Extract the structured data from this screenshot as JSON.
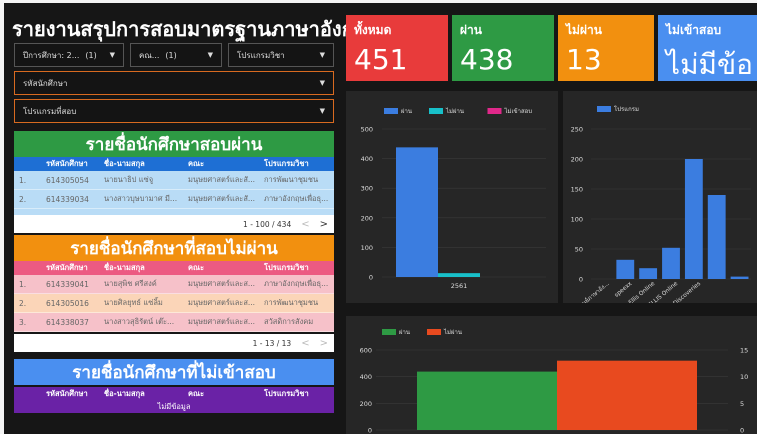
{
  "title": "รายงานสรุปการสอบมาตรฐานภาษาอังกฤษ",
  "filters": {
    "year": {
      "label": "ปีการศึกษา: 2...",
      "count": "(1)"
    },
    "faculty": {
      "label": "คณ...",
      "count": "(1)"
    },
    "program": {
      "label": "โปรแกรมวิชา"
    },
    "student_id": {
      "label": "รหัสนักศึกษา"
    },
    "exam_program": {
      "label": "โปรแกรมที่สอบ"
    }
  },
  "colors": {
    "passed": "#2e9a44",
    "failed": "#f2900f",
    "absent": "#4a8ff0",
    "total": "#e83b3b",
    "purple": "#6a22a6"
  },
  "cards": [
    {
      "label": "ทั้งหมด",
      "value": "451"
    },
    {
      "label": "ผ่าน",
      "value": "438"
    },
    {
      "label": "ไม่ผ่าน",
      "value": "13"
    },
    {
      "label": "ไม่เข้าสอบ",
      "value": "ไม่มีข้อ"
    }
  ],
  "columns": [
    "รหัสนักศึกษา",
    "ชื่อ-นามสกุล",
    "คณะ",
    "โปรแกรมวิชา"
  ],
  "passed": {
    "title": "รายชื่อนักศึกษาสอบผ่าน",
    "rows": [
      {
        "no": "1.",
        "id": "614305054",
        "name": "นายนาธิป แซ่จู",
        "faculty": "มนุษยศาสตร์และสั...",
        "program": "การพัฒนาชุมชน"
      },
      {
        "no": "2.",
        "id": "614339034",
        "name": "นางสาวบุษบามาศ มี...",
        "faculty": "มนุษยศาสตร์และสั...",
        "program": "ภาษาอังกฤษเพื่อธุ..."
      }
    ],
    "pager": "1 - 100 / 434"
  },
  "failed": {
    "title": "รายชื่อนักศึกษาที่สอบไม่ผ่าน",
    "rows": [
      {
        "no": "1.",
        "id": "614339041",
        "name": "นายสุพิช ศรีสงค์",
        "faculty": "มนุษยศาสตร์และส...",
        "program": "ภาษาอังกฤษเพื่อธุ..."
      },
      {
        "no": "2.",
        "id": "614305016",
        "name": "นายศิลยุทธ์ แซ่ลิ้ม",
        "faculty": "มนุษยศาสตร์และส...",
        "program": "การพัฒนาชุมชน"
      },
      {
        "no": "3.",
        "id": "614338037",
        "name": "นางสาวสุธิรัตน์ เต๊ะ...",
        "faculty": "มนุษยศาสตร์และส...",
        "program": "สวัสดิการสังคม"
      }
    ],
    "pager": "1 - 13 / 13"
  },
  "absent": {
    "title": "รายชื่อนักศึกษาที่ไม่เข้าสอบ",
    "empty": "ไม่มีข้อมูล"
  },
  "chart_data": [
    {
      "type": "bar",
      "legend": [
        "ผ่าน",
        "ไม่ผ่าน",
        "ไม่เข้าสอบ"
      ],
      "colors": [
        "#3b7de0",
        "#18c0c9",
        "#e0288a"
      ],
      "categories": [
        "2561"
      ],
      "series": [
        {
          "name": "ผ่าน",
          "values": [
            438
          ]
        },
        {
          "name": "ไม่ผ่าน",
          "values": [
            13
          ]
        },
        {
          "name": "ไม่เข้าสอบ",
          "values": [
            0
          ]
        }
      ],
      "yticks": [
        0,
        100,
        200,
        300,
        400,
        500
      ],
      "ylim": [
        0,
        500
      ]
    },
    {
      "type": "bar",
      "legend": [
        "โปรแกรม"
      ],
      "colors": [
        "#3b7de0"
      ],
      "categories": [
        "ศูนย์ภาษาอัง...",
        "speexx",
        "Ellis Online",
        "ELLIS Online",
        "ELLIS Discoveries",
        ""
      ],
      "series": [
        {
          "name": "โปรแกรม",
          "values": [
            0,
            32,
            18,
            52,
            200,
            140,
            4
          ]
        }
      ],
      "yticks": [
        0,
        50,
        100,
        150,
        200,
        250
      ],
      "ylim": [
        0,
        250
      ]
    },
    {
      "type": "bar",
      "legend": [
        "ผ่าน",
        "ไม่ผ่าน"
      ],
      "colors": [
        "#2e9a44",
        "#e84a1f"
      ],
      "series": [
        {
          "name": "ผ่าน",
          "values": [
            438
          ]
        },
        {
          "name": "ไม่ผ่าน",
          "values": [
            13
          ]
        }
      ],
      "yticks": [
        0,
        200,
        400,
        600
      ],
      "y2ticks": [
        0,
        5,
        10,
        15
      ],
      "ylim": [
        0,
        600
      ],
      "y2lim": [
        0,
        15
      ]
    }
  ]
}
